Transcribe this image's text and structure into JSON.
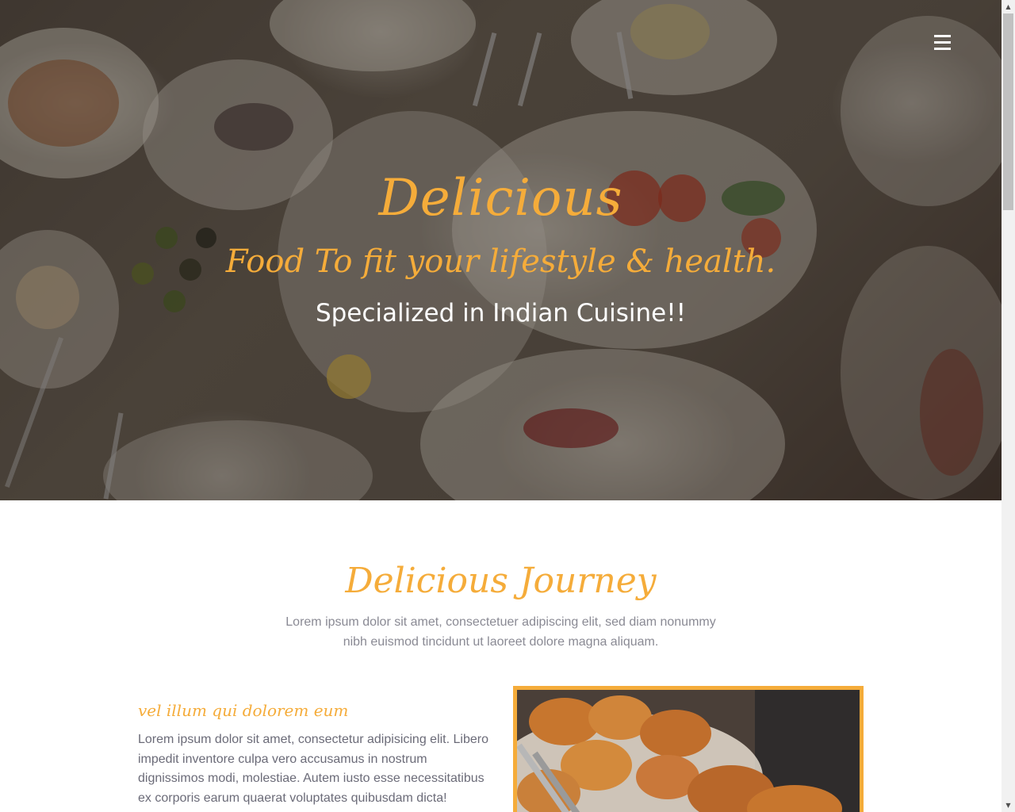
{
  "hero": {
    "title": "Delicious",
    "subtitle": "Food To fit your lifestyle & health.",
    "tagline": "Specialized in Indian Cuisine!!",
    "menu_icon": "hamburger-menu-icon"
  },
  "journey": {
    "title": "Delicious Journey",
    "intro": "Lorem ipsum dolor sit amet, consectetuer adipiscing elit, sed diam nonummy nibh euismod tincidunt ut laoreet dolore magna aliquam.",
    "feature": {
      "heading": "vel illum qui dolorem eum",
      "body": "Lorem ipsum dolor sit amet, consectetur adipisicing elit. Libero impedit inventore culpa vero accusamus in nostrum dignissimos modi, molestiae. Autem iusto esse necessitatibus ex corporis earum quaerat voluptates quibusdam dicta!"
    }
  },
  "colors": {
    "accent": "#f5ac3a",
    "body_text": "#6b6b78",
    "muted_text": "#8a8a94"
  }
}
